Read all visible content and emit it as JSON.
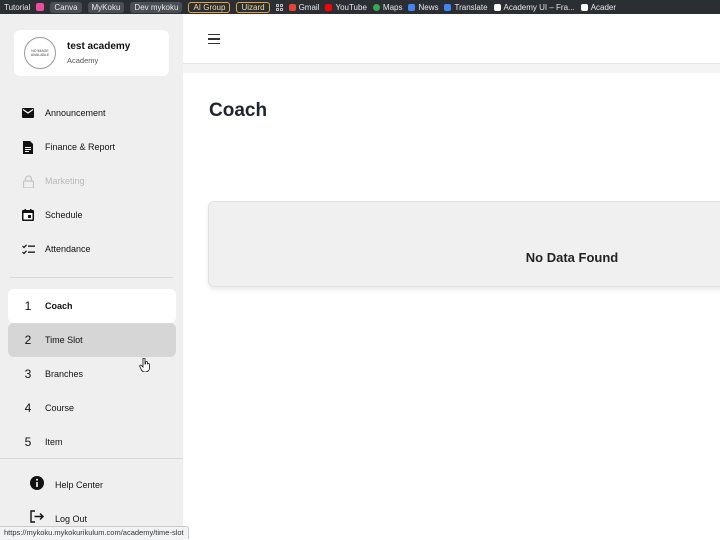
{
  "bookmarks": [
    {
      "label": "Tutorial",
      "style": "plain"
    },
    {
      "label": "",
      "style": "pink-square"
    },
    {
      "label": "Canva",
      "style": "pill"
    },
    {
      "label": "MyKoku",
      "style": "pill"
    },
    {
      "label": "Dev mykoku",
      "style": "pill"
    },
    {
      "label": "AI Group",
      "style": "outlined"
    },
    {
      "label": "Uizard",
      "style": "outlined"
    },
    {
      "label": "",
      "style": "apps"
    },
    {
      "label": "Gmail",
      "style": "icon",
      "color": "#ea4335"
    },
    {
      "label": "YouTube",
      "style": "icon",
      "color": "#ff0000"
    },
    {
      "label": "Maps",
      "style": "icon",
      "color": "#34a853"
    },
    {
      "label": "News",
      "style": "icon",
      "color": "#4285f4"
    },
    {
      "label": "Translate",
      "style": "icon",
      "color": "#4285f4"
    },
    {
      "label": "Academy UI – Fra...",
      "style": "icon",
      "color": "#ffffff"
    },
    {
      "label": "Acader",
      "style": "icon",
      "color": "#ffffff"
    }
  ],
  "profile": {
    "name": "test academy",
    "role": "Academy",
    "avatar_text": "NO IMAGE AVAILABLE"
  },
  "menu": [
    {
      "label": "Announcement",
      "icon": "mail-icon",
      "disabled": false
    },
    {
      "label": "Finance & Report",
      "icon": "document-icon",
      "disabled": false
    },
    {
      "label": "Marketing",
      "icon": "lock-icon",
      "disabled": true
    },
    {
      "label": "Schedule",
      "icon": "calendar-icon",
      "disabled": false
    },
    {
      "label": "Attendance",
      "icon": "checklist-icon",
      "disabled": false
    }
  ],
  "numbered_menu": [
    {
      "num": "1",
      "label": "Coach",
      "state": "active"
    },
    {
      "num": "2",
      "label": "Time Slot",
      "state": "hover"
    },
    {
      "num": "3",
      "label": "Branches",
      "state": "normal"
    },
    {
      "num": "4",
      "label": "Course",
      "state": "normal"
    },
    {
      "num": "5",
      "label": "Item",
      "state": "normal"
    }
  ],
  "footer": {
    "help_label": "Help Center",
    "logout_label": "Log Out"
  },
  "page": {
    "title": "Coach",
    "empty_message": "No Data Found"
  },
  "status_url": "https://mykoku.mykokurikulum.com/academy/time-slot"
}
